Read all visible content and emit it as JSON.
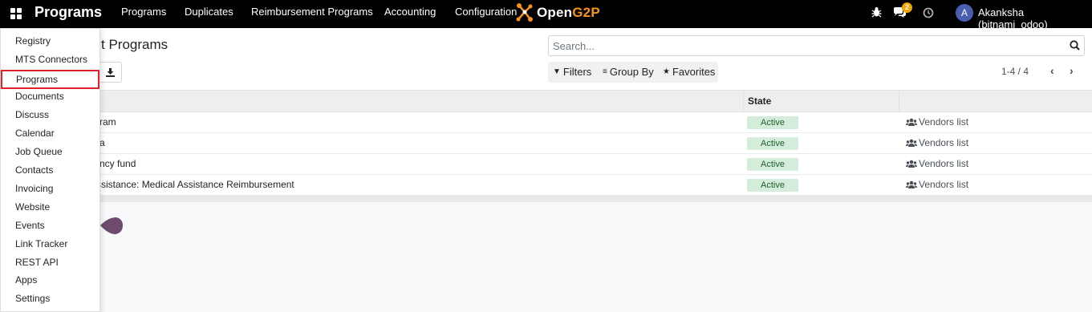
{
  "navbar": {
    "app_title": "Programs",
    "menus": [
      "Programs",
      "Duplicates",
      "Reimbursement Programs",
      "Accounting",
      "Configuration"
    ],
    "logo_prefix": "Open",
    "logo_suffix": "G2P",
    "chat_badge": "2",
    "avatar_letter": "A",
    "user_name": "Akanksha (bitnami_odoo)"
  },
  "control_panel": {
    "title": "t Programs",
    "search_placeholder": "Search...",
    "filters_label": "Filters",
    "groupby_label": "Group By",
    "favorites_label": "Favorites",
    "pager": "1-4 / 4"
  },
  "table": {
    "state_header": "State",
    "rows": [
      {
        "name": "ram",
        "state": "Active",
        "action": "Vendors list"
      },
      {
        "name": "a",
        "state": "Active",
        "action": "Vendors list"
      },
      {
        "name": "ncy fund",
        "state": "Active",
        "action": "Vendors list"
      },
      {
        "name": "ssistance: Medical Assistance Reimbursement",
        "state": "Active",
        "action": "Vendors list"
      }
    ]
  },
  "dropdown": {
    "items": [
      "Registry",
      "MTS Connectors",
      "Programs",
      "Documents",
      "Discuss",
      "Calendar",
      "Job Queue",
      "Contacts",
      "Invoicing",
      "Website",
      "Events",
      "Link Tracker",
      "REST API",
      "Apps",
      "Settings"
    ],
    "highlighted": "Programs"
  },
  "colors": {
    "navbar_bg": "#000000",
    "logo_accent": "#f7941d",
    "badge": "#f0a500",
    "state_active_bg": "#d4edda",
    "highlight_border": "#e0202a",
    "blob": "#6e4a6c"
  }
}
